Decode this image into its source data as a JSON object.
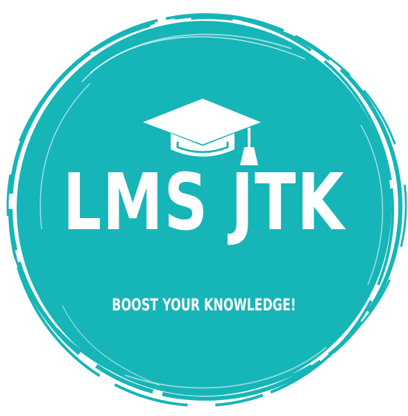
{
  "logo": {
    "title": "LMS JTK",
    "tagline": "BOOST YOUR KNOWLEDGE!",
    "icon": "graduation-cap-icon",
    "colors": {
      "circle": "#16b5b8",
      "text": "#ffffff",
      "background": "#ffffff"
    }
  }
}
